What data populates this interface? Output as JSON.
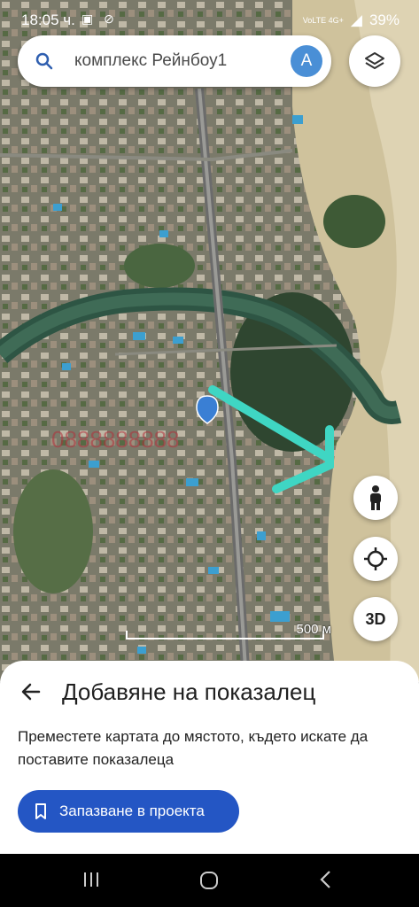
{
  "status_bar": {
    "time": "18:05 ч.",
    "notification_icons": [
      "image-icon",
      "alarm-off-icon"
    ],
    "network": "VoLTE 4G+",
    "battery": "39%"
  },
  "search": {
    "query": "комплекс Рейнбоу1",
    "avatar_letter": "A"
  },
  "map": {
    "layers_icon": "layers-icon",
    "pegman_icon": "pegman-icon",
    "location_icon": "my-location-icon",
    "view_3d_label": "3D",
    "scale_label": "500 м",
    "watermark": "0888888888",
    "colors": {
      "annotation_arrow": "#3fd6c3",
      "river": "#3a5a4a",
      "sand": "#d6c9a4"
    }
  },
  "sheet": {
    "title": "Добавяне на показалец",
    "description": "Преместете картата до мястото, където искате да поставите показалеца",
    "save_button": "Запазване в проекта",
    "colors": {
      "primary": "#2456c4"
    }
  },
  "nav_bar": {
    "buttons": [
      "recents-icon",
      "home-icon",
      "back-icon"
    ]
  }
}
